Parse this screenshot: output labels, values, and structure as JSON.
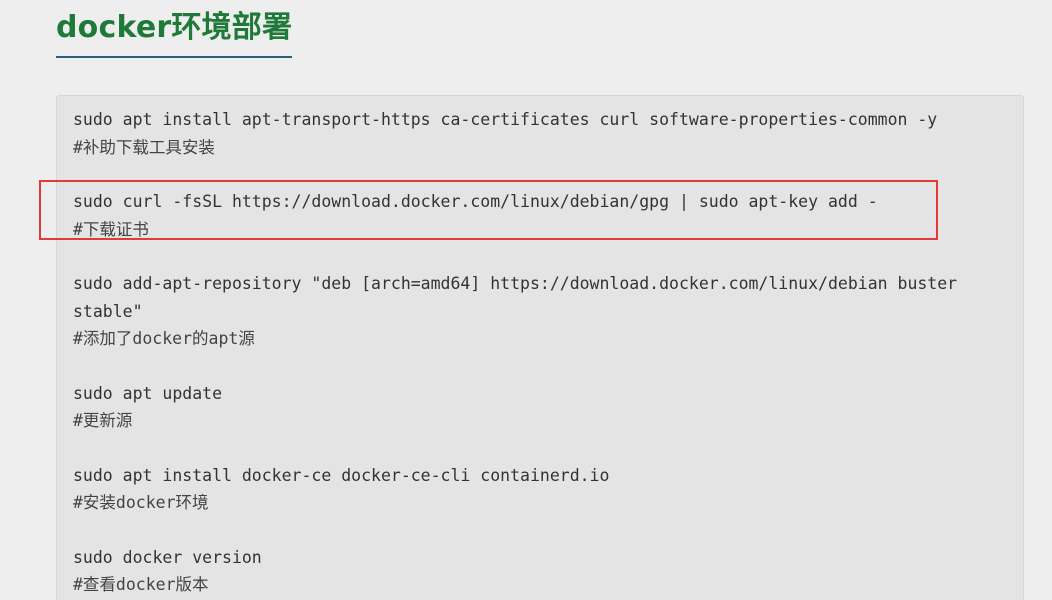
{
  "heading": "docker环境部署",
  "commands": [
    {
      "cmd": "sudo apt install apt-transport-https ca-certificates curl software-properties-common -y",
      "comment": "#补助下载工具安装"
    },
    {
      "cmd": "sudo curl -fsSL https://download.docker.com/linux/debian/gpg | sudo apt-key add -",
      "comment": "#下载证书"
    },
    {
      "cmd": "sudo add-apt-repository \"deb [arch=amd64] https://download.docker.com/linux/debian buster stable\"",
      "comment": "#添加了docker的apt源"
    },
    {
      "cmd": "sudo apt update",
      "comment": "#更新源"
    },
    {
      "cmd": "sudo apt install docker-ce docker-ce-cli containerd.io",
      "comment": "#安装docker环境"
    },
    {
      "cmd": "sudo docker version",
      "comment": "#查看docker版本"
    }
  ],
  "highlight": {
    "color": "#e23b37"
  },
  "colors": {
    "heading": "#1f7a3a",
    "background": "#eeeeee",
    "code_background": "#e4e4e4"
  }
}
